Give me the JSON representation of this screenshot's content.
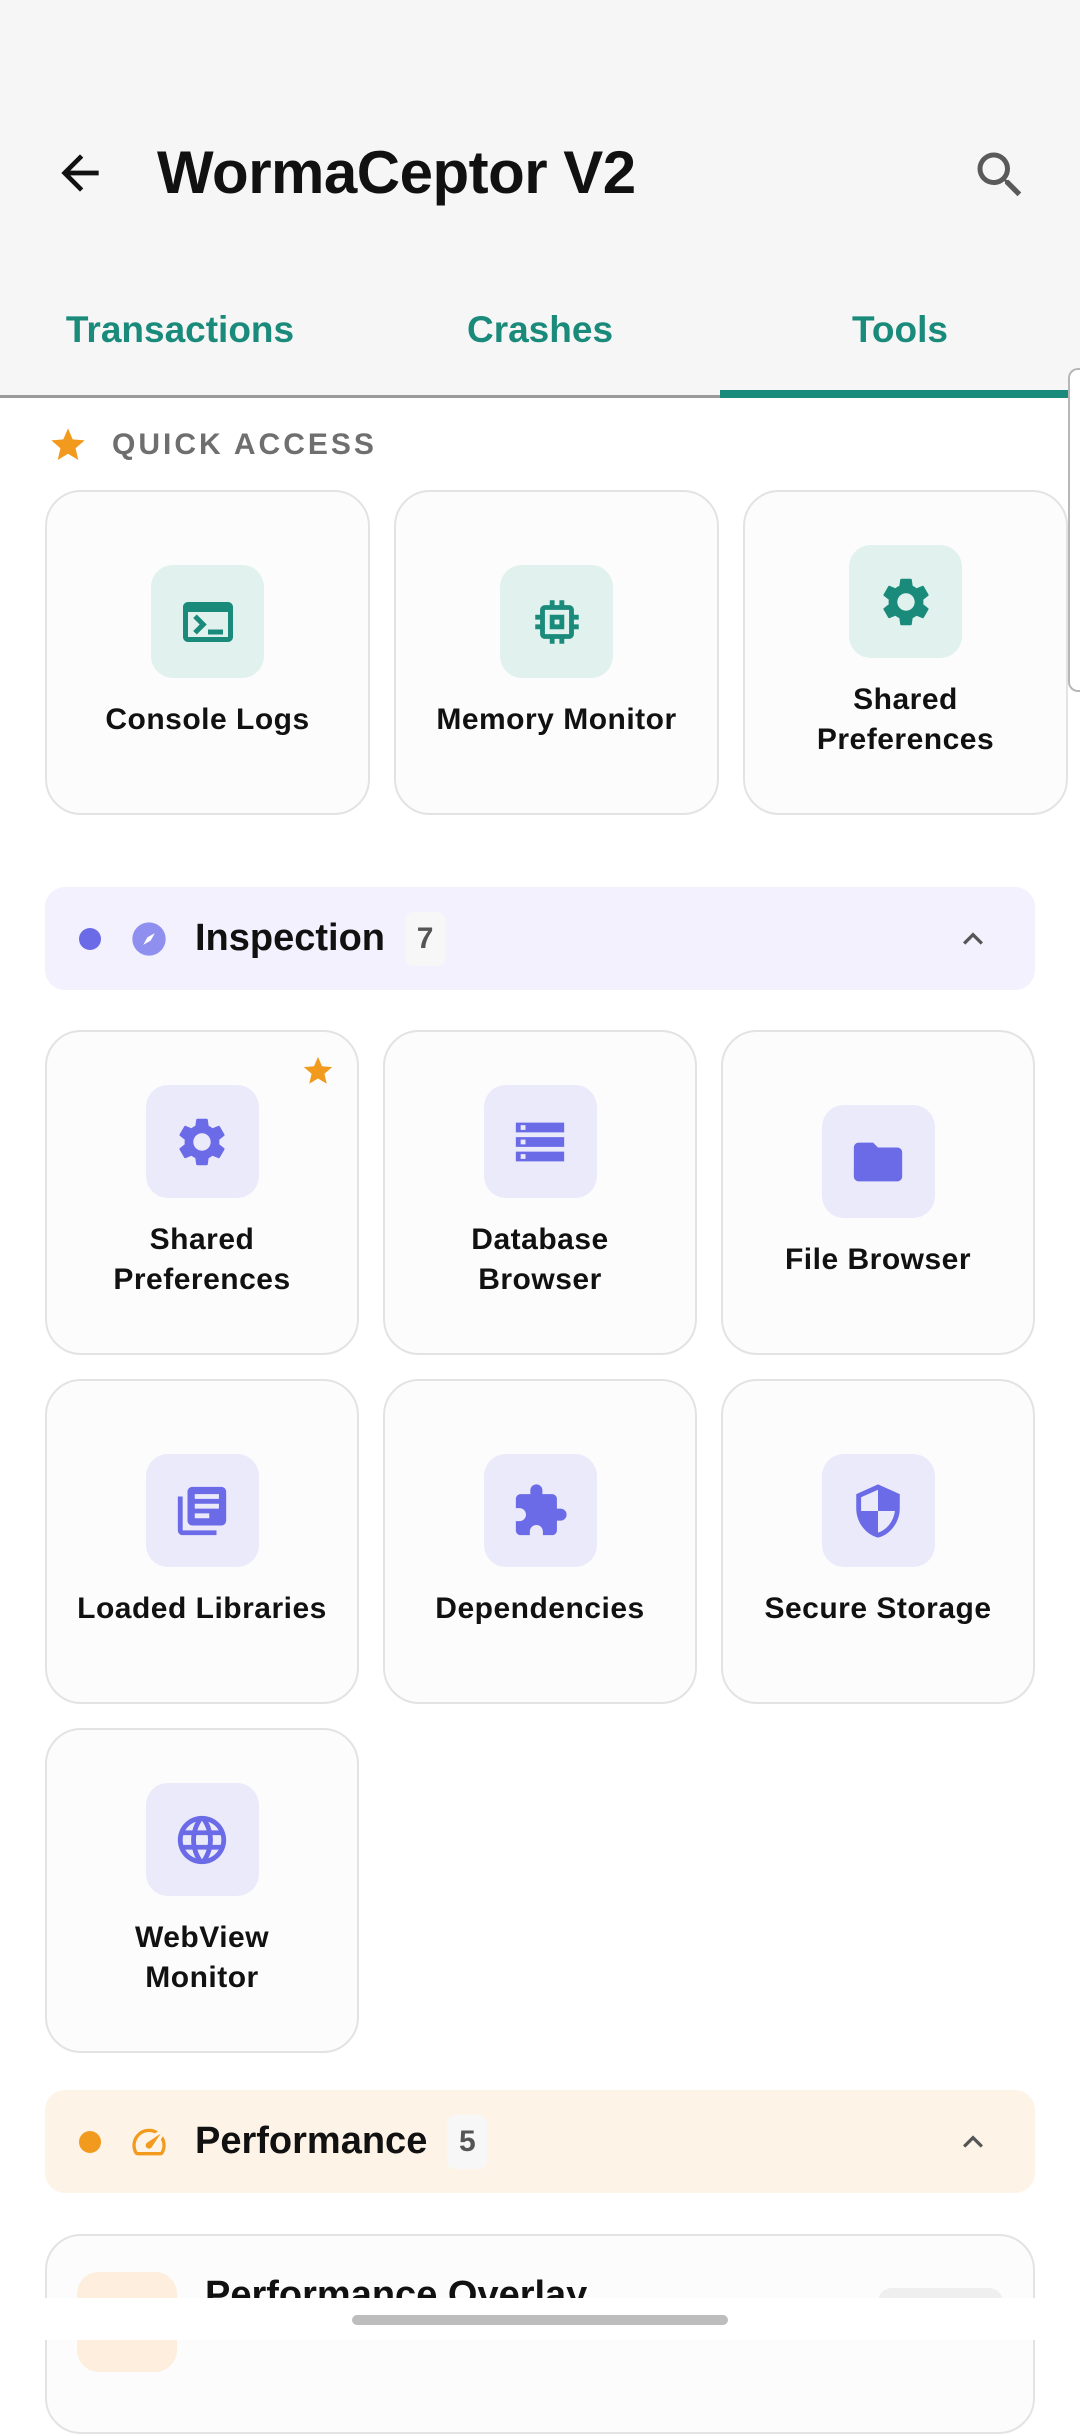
{
  "app": {
    "title": "WormaCeptor V2"
  },
  "tabs": [
    {
      "label": "Transactions",
      "selected": false
    },
    {
      "label": "Crashes",
      "selected": false
    },
    {
      "label": "Tools",
      "selected": true
    }
  ],
  "quick_access": {
    "label": "QUICK ACCESS",
    "items": [
      {
        "label": "Console Logs",
        "icon": "terminal-icon"
      },
      {
        "label": "Memory Monitor",
        "icon": "memory-chip-icon"
      },
      {
        "label": "Shared\nPreferences",
        "icon": "gear-icon"
      }
    ]
  },
  "sections": {
    "inspection": {
      "title": "Inspection",
      "count": "7",
      "color": "#6b6be8",
      "items": [
        {
          "label": "Shared\nPreferences",
          "icon": "gear-icon",
          "favorite": true
        },
        {
          "label": "Database\nBrowser",
          "icon": "database-icon"
        },
        {
          "label": "File Browser",
          "icon": "folder-icon"
        },
        {
          "label": "Loaded Libraries",
          "icon": "library-icon"
        },
        {
          "label": "Dependencies",
          "icon": "puzzle-icon"
        },
        {
          "label": "Secure Storage",
          "icon": "shield-icon"
        },
        {
          "label": "WebView\nMonitor",
          "icon": "globe-icon"
        }
      ]
    },
    "performance": {
      "title": "Performance",
      "count": "5",
      "color": "#f29a1e",
      "first_item": "Performance Overlay"
    }
  },
  "colors": {
    "accent": "#1a8a7a",
    "star": "#f29a1e",
    "violet": "#6b6be8"
  }
}
